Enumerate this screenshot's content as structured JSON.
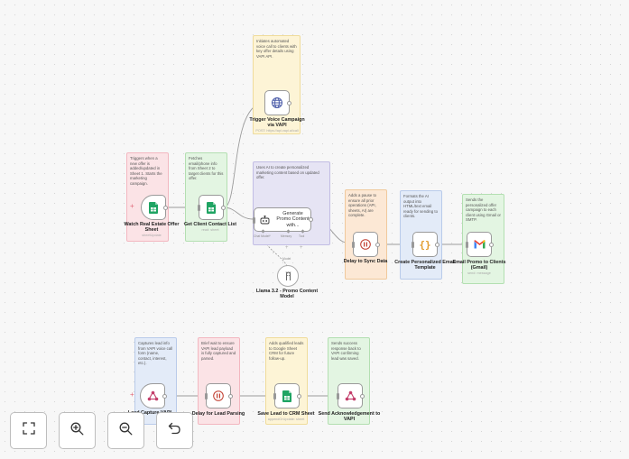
{
  "workflow": {
    "colors": {
      "pink": "#fbe3e6",
      "green": "#e3f5e2",
      "yellow": "#fdf4d6",
      "blue": "#e3ebf8",
      "orange": "#fce8d5",
      "purple": "#e6e4f4",
      "accent_red": "#e06a7a"
    },
    "notes": {
      "trigger_voice": "Initiates automated voice call to clients with key offer details using VAPI API.",
      "watch_sheet": "Triggers when a new offer is added/updated in Sheet 1. Starts the marketing campaign.",
      "get_contacts": "Fetches email/phone info from Sheet 2 to target clients for this offer.",
      "generate_promo": "Uses AI to create personalized marketing content based on updated offer.",
      "delay_sync": "Adds a pause to ensure all prior operations (API, sheets, AI) are complete.",
      "format_email": "Formats the AI output into HTML/text email ready for sending to clients.",
      "email_promo": "Sends the personalized offer campaign to each client using Gmail or SMTP.",
      "capture_lead": "Captures lead info from VAPI voice call form (name, contact, interest, etc.).",
      "delay_lead": "Brief wait to ensure VAPI lead payload is fully captured and parsed.",
      "save_lead": "Adds qualified leads to Google Sheet CRM for future follow-up.",
      "send_ack": "Sends success response back to VAPI confirming lead was saved."
    },
    "nodes": {
      "trigger_voice": {
        "label": "Trigger Voice Campaign via VAPI",
        "sub": "POST: https://api.vapi.ai/call",
        "icon": "globe-icon"
      },
      "watch_sheet": {
        "label": "Watch Real Estate Offer Sheet",
        "sub": "sheetUpdate",
        "icon": "google-sheets-icon"
      },
      "get_contacts": {
        "label": "Get Client Contact List",
        "sub": "read: sheet",
        "icon": "google-sheets-icon"
      },
      "generate_promo": {
        "label": "Generate Promo Content with...",
        "icon": "robot-icon",
        "chat_model": "Chat Model*",
        "memory": "Memory",
        "tool": "Tool"
      },
      "llama_model": {
        "label": "Llama 3.2 - Promo Content Model",
        "model_label": "Model",
        "icon": "llama-icon"
      },
      "delay_sync": {
        "label": "Delay to Sync Data",
        "icon": "pause-icon"
      },
      "format_email": {
        "label": "Create Personalized Email Template",
        "icon": "code-braces-icon"
      },
      "email_promo": {
        "label": "Email Promo to Clients (Gmail)",
        "sub": "send: message",
        "icon": "gmail-icon"
      },
      "capture_lead": {
        "label": "Lead Capture VAPI",
        "label_a": "Lead C",
        "label_b": "VAPI",
        "icon": "webhook-icon"
      },
      "delay_lead": {
        "label": "Delay for Lead Parsing",
        "icon": "pause-icon"
      },
      "save_lead": {
        "label": "Save Lead to CRM Sheet",
        "sub": "appendOrUpdate: sheet",
        "icon": "google-sheets-icon"
      },
      "send_ack": {
        "label": "Send Acknowledgement to VAPI",
        "icon": "webhook-icon"
      }
    }
  },
  "controls": {
    "fit_view": "fit-view-icon",
    "zoom_in": "zoom-in-icon",
    "zoom_out": "zoom-out-icon",
    "undo": "undo-icon"
  }
}
